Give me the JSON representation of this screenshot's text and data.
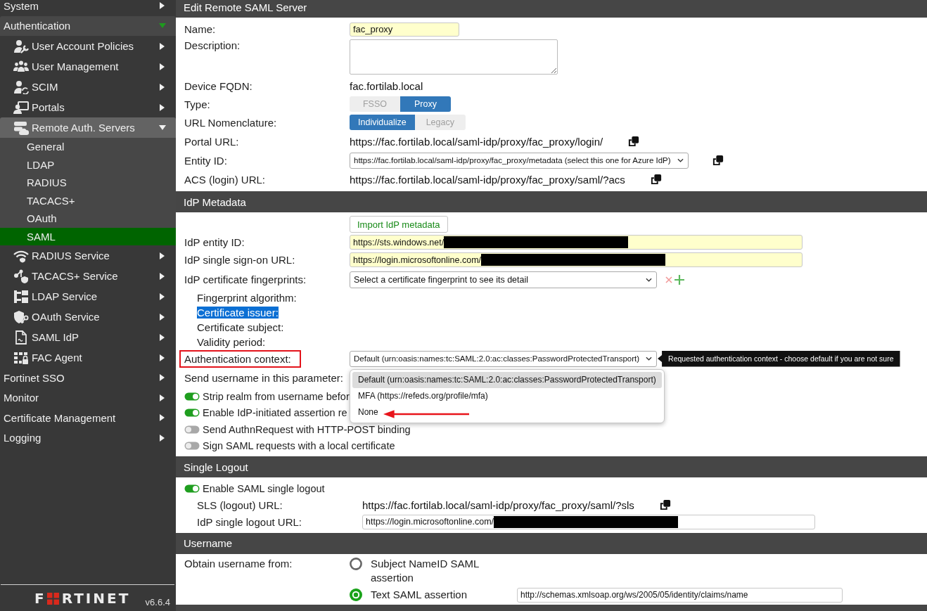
{
  "sidebar": {
    "items": [
      {
        "label": "System",
        "expanded": false
      },
      {
        "label": "Authentication",
        "expanded": true,
        "children": [
          {
            "label": "User Account Policies",
            "expanded": false
          },
          {
            "label": "User Management",
            "expanded": false
          },
          {
            "label": "SCIM",
            "expanded": false
          },
          {
            "label": "Portals",
            "expanded": false
          },
          {
            "label": "Remote Auth. Servers",
            "expanded": true,
            "children": [
              {
                "label": "General",
                "selected": false
              },
              {
                "label": "LDAP",
                "selected": false
              },
              {
                "label": "RADIUS",
                "selected": false
              },
              {
                "label": "TACACS+",
                "selected": false
              },
              {
                "label": "OAuth",
                "selected": false
              },
              {
                "label": "SAML",
                "selected": true
              }
            ]
          },
          {
            "label": "RADIUS Service",
            "expanded": false
          },
          {
            "label": "TACACS+ Service",
            "expanded": false
          },
          {
            "label": "LDAP Service",
            "expanded": false
          },
          {
            "label": "OAuth Service",
            "expanded": false
          },
          {
            "label": "SAML IdP",
            "expanded": false
          },
          {
            "label": "FAC Agent",
            "expanded": false
          }
        ]
      },
      {
        "label": "Fortinet SSO",
        "expanded": false
      },
      {
        "label": "Monitor",
        "expanded": false
      },
      {
        "label": "Certificate Management",
        "expanded": false
      },
      {
        "label": "Logging",
        "expanded": false
      }
    ],
    "logo": {
      "left": "F",
      "right": "RTINET"
    },
    "version": "v6.6.4"
  },
  "sections": [
    {
      "title": "Edit Remote SAML Server",
      "rows": [
        {
          "kind": "input",
          "label": "Name:",
          "value": "fac_proxy",
          "required": true
        },
        {
          "kind": "textarea",
          "label": "Description:"
        },
        {
          "kind": "text",
          "label": "Device FQDN:",
          "value": "fac.fortilab.local"
        },
        {
          "kind": "segmented",
          "label": "Type:",
          "options": [
            {
              "label": "FSSO",
              "selected": false
            },
            {
              "label": "Proxy",
              "selected": true
            }
          ]
        },
        {
          "kind": "segmented",
          "label": "URL Nomenclature:",
          "options": [
            {
              "label": "Individualize",
              "selected": true
            },
            {
              "label": "Legacy",
              "selected": false
            }
          ]
        },
        {
          "kind": "copy_text",
          "label": "Portal URL:",
          "value": "https://fac.fortilab.local/saml-idp/proxy/fac_proxy/login/"
        },
        {
          "kind": "select",
          "label": "Entity ID:",
          "value": "https://fac.fortilab.local/saml-idp/proxy/fac_proxy/metadata (select this one for Azure IdP)",
          "copy": true
        },
        {
          "kind": "copy_text",
          "label": "ACS (login) URL:",
          "value": "https://fac.fortilab.local/saml-idp/proxy/fac_proxy/saml/?acs"
        }
      ]
    },
    {
      "title": "IdP Metadata",
      "rows": [
        {
          "kind": "button",
          "label": "Import IdP metadata"
        },
        {
          "kind": "input",
          "label": "IdP entity ID:",
          "value": "https://sts.windows.net/",
          "required": true,
          "redacted": true
        },
        {
          "kind": "input",
          "label": "IdP single sign-on URL:",
          "value": "https://login.microsoftonline.com/",
          "required": true,
          "redacted": true
        },
        {
          "kind": "select",
          "label": "IdP certificate fingerprints:",
          "value": "Select a certificate fingerprint to see its detail",
          "actions": true
        },
        {
          "kind": "detail",
          "label": "Fingerprint algorithm:",
          "highlighted": false
        },
        {
          "kind": "detail",
          "label": "Certificate issuer:",
          "highlighted": true
        },
        {
          "kind": "detail",
          "label": "Certificate subject:",
          "highlighted": false
        },
        {
          "kind": "detail",
          "label": "Validity period:",
          "highlighted": false
        },
        {
          "kind": "select",
          "label": "Authentication context:",
          "value": "Default (urn:oasis:names:tc:SAML:2.0:ac:classes:PasswordProtectedTransport)",
          "annotated": true,
          "tooltip": "Requested authentication context - choose default if you are not sure",
          "open": true,
          "options": [
            {
              "label": "Default (urn:oasis:names:tc:SAML:2.0:ac:classes:PasswordProtectedTransport)",
              "selected": true,
              "pointer": false
            },
            {
              "label": "MFA (https://refeds.org/profile/mfa)",
              "selected": false,
              "pointer": false
            },
            {
              "label": "None",
              "selected": false,
              "pointer": true
            }
          ]
        },
        {
          "kind": "label",
          "label": "Send username in this parameter:"
        },
        {
          "kind": "toggle",
          "label": "Strip realm from username befor",
          "on": true
        },
        {
          "kind": "toggle",
          "label": "Enable IdP-initiated assertion re",
          "on": true
        },
        {
          "kind": "toggle",
          "label": "Send AuthnRequest with HTTP-POST binding",
          "on": false
        },
        {
          "kind": "toggle",
          "label": "Sign SAML requests with a local certificate",
          "on": false
        }
      ]
    },
    {
      "title": "Single Logout",
      "rows": [
        {
          "kind": "toggle",
          "label": "Enable SAML single logout",
          "on": true,
          "children": [
            {
              "kind": "copy_text",
              "label": "SLS (logout) URL:",
              "value": "https://fac.fortilab.local/saml-idp/proxy/fac_proxy/saml/?sls"
            },
            {
              "kind": "input",
              "label": "IdP single logout URL:",
              "value": "https://login.microsoftonline.com/",
              "required": false,
              "redacted": true
            }
          ]
        }
      ]
    },
    {
      "title": "Username",
      "rows": [
        {
          "kind": "radio",
          "label": "Obtain username from:",
          "options": [
            {
              "label": "Subject NameID SAML assertion",
              "selected": false
            },
            {
              "label": "Text SAML assertion",
              "selected": true,
              "value": "http://schemas.xmlsoap.org/ws/2005/05/identity/claims/name"
            }
          ]
        }
      ]
    }
  ]
}
